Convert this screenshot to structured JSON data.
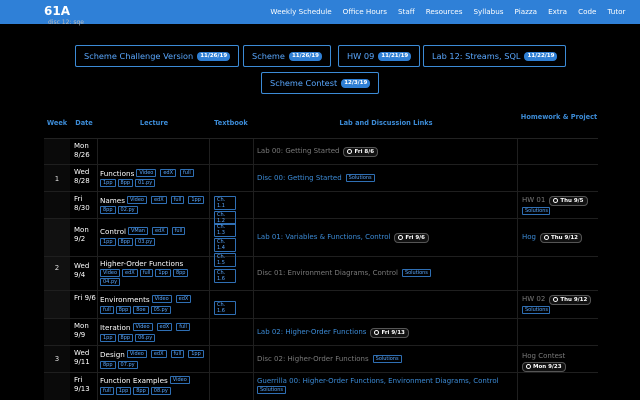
{
  "nav": {
    "logo": "61A",
    "items": [
      "Weekly Schedule",
      "Office Hours",
      "Staff",
      "Resources",
      "Syllabus",
      "Piazza",
      "Extra",
      "Code",
      "Tutor"
    ]
  },
  "subline": "disc 12: sqe",
  "assignments": [
    {
      "label": "Scheme Challenge Version",
      "due": "11/26/19"
    },
    {
      "label": "Scheme",
      "due": "11/26/19"
    },
    {
      "label": "HW 09",
      "due": "11/21/19"
    },
    {
      "label": "Lab 12: Streams, SQL",
      "due": "11/22/19"
    },
    {
      "label": "Scheme Contest",
      "due": "12/3/19"
    }
  ],
  "table_headers": {
    "week": "Week",
    "date": "Date",
    "lecture": "Lecture",
    "textbook": "Textbook",
    "lab": "Lab and Discussion Links",
    "hw": "Homework & Project"
  },
  "rows": [
    {
      "date": "Mon 8/26",
      "lecture": "",
      "tags": [],
      "textbook": [],
      "lab": "Lab 00: Getting Started",
      "lab_due": "Fri 8/6",
      "lab_solutions": false,
      "hw": "",
      "hw_due": "",
      "hw_solutions": false
    },
    {
      "date": "Wed 8/28",
      "lecture": "Functions",
      "tags": [
        "Video",
        "edX",
        "full",
        "1pp",
        "8pp",
        "01.py"
      ],
      "textbook": [],
      "lab": "Disc 00: Getting Started",
      "lab_due": "",
      "lab_solutions": true,
      "hw": "",
      "hw_due": "",
      "hw_solutions": false
    },
    {
      "date": "Fri 8/30",
      "lecture": "Names",
      "tags": [
        "Video",
        "edX",
        "full",
        "1pp",
        "8pp",
        "02.py"
      ],
      "textbook": [
        "Ch. 1.1",
        "Ch. 1.2"
      ],
      "lab": "",
      "lab_due": "",
      "lab_solutions": false,
      "hw": "HW 01",
      "hw_due": "Thu 9/5",
      "hw_solutions": true
    },
    {
      "date": "Mon 9/2",
      "lecture": "Control",
      "tags": [
        "VMan",
        "edX",
        "full",
        "1pp",
        "8pp",
        "03.py"
      ],
      "textbook": [
        "Ch. 1.3",
        "Ch. 1.4",
        "Ch. 1.5"
      ],
      "lab": "Lab 01: Variables & Functions, Control",
      "lab_due": "Fri 9/6",
      "lab_solutions": false,
      "hw": "Hog",
      "hw_due": "Thu 9/12",
      "hw_solutions": false
    },
    {
      "date": "Wed 9/4",
      "lecture": "Higher-Order Functions",
      "tags": [
        "Video",
        "edX",
        "full",
        "1pp",
        "8pp",
        "04.py"
      ],
      "textbook": [
        "Ch. 1.6"
      ],
      "lab": "Disc 01: Environment Diagrams, Control",
      "lab_due": "",
      "lab_solutions": true,
      "hw": "",
      "hw_due": "",
      "hw_solutions": false
    },
    {
      "date": "Fri 9/6",
      "lecture": "Environments",
      "tags": [
        "Video",
        "edX",
        "full",
        "8pp",
        "8oe",
        "05.py"
      ],
      "textbook": [
        "Ch. 1.6"
      ],
      "lab": "",
      "lab_due": "",
      "lab_solutions": false,
      "hw": "HW 02",
      "hw_due": "Thu 9/12",
      "hw_solutions": true
    },
    {
      "date": "Mon 9/9",
      "lecture": "Iteration",
      "tags": [
        "Video",
        "edX",
        "full",
        "1pp",
        "8pp",
        "06.py"
      ],
      "textbook": [],
      "lab": "Lab 02: Higher-Order Functions",
      "lab_due": "Fri 9/13",
      "lab_solutions": false,
      "hw": "",
      "hw_due": "",
      "hw_solutions": false
    },
    {
      "date": "Wed 9/11",
      "lecture": "Design",
      "tags": [
        "Video",
        "edX",
        "full",
        "1pp",
        "8pp",
        "07.py"
      ],
      "textbook": [],
      "lab": "Disc 02: Higher-Order Functions",
      "lab_due": "",
      "lab_solutions": true,
      "hw": "Hog Contest",
      "hw_due": "Mon 9/23",
      "hw_solutions": false
    },
    {
      "date": "Fri 9/13",
      "lecture": "Function Examples",
      "tags": [
        "Video",
        "full",
        "1pp",
        "8pp",
        "08.py"
      ],
      "textbook": [],
      "lab": "Guerrilla 00: Higher-Order Functions, Environment Diagrams, Control",
      "lab_due": "",
      "lab_solutions": true,
      "hw": "",
      "hw_due": "",
      "hw_solutions": false
    }
  ],
  "weeks": [
    "1",
    "2",
    "3"
  ],
  "solutions_label": "Solutions"
}
